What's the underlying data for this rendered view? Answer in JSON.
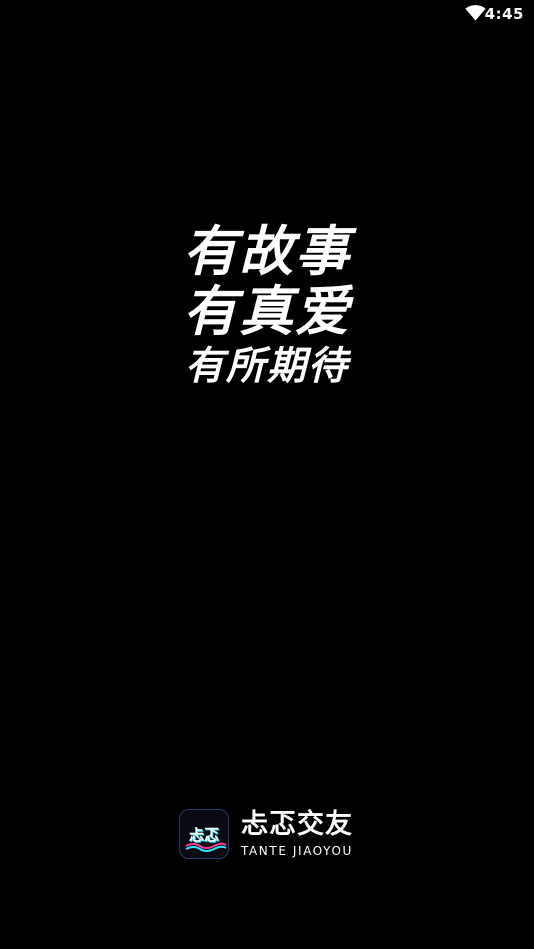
{
  "status_bar": {
    "time": "4:45",
    "wifi_icon": "wifi-icon"
  },
  "slogan": {
    "lines": [
      "有故事",
      "有真爱",
      "有所期待"
    ]
  },
  "brand": {
    "name": "忐忑交友",
    "subtitle": "TANTE JIAOYOU",
    "icon": "app-logo-icon",
    "icon_glyphs": "忐忑",
    "colors": {
      "accent_pink": "#ff3c8e",
      "accent_cyan": "#2ee6ff",
      "icon_border": "#2a3a6a"
    }
  }
}
